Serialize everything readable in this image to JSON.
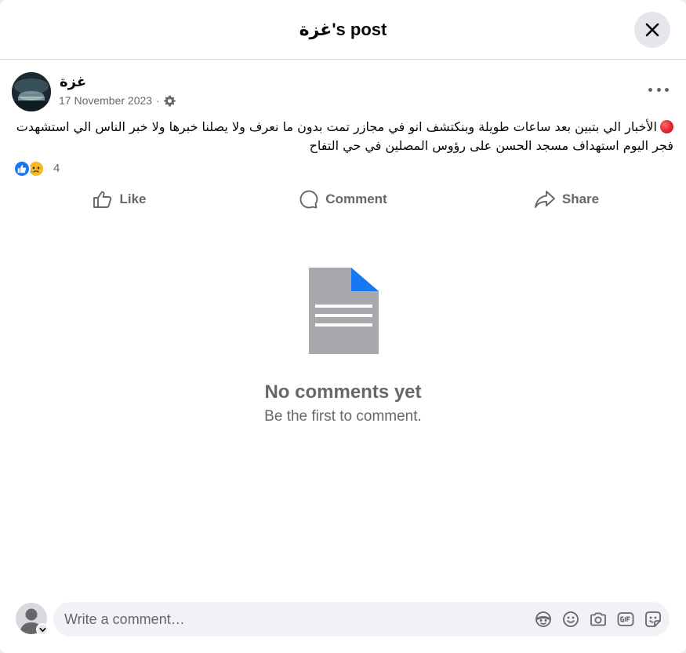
{
  "header": {
    "title": "غزة's post"
  },
  "post": {
    "author": "غزة",
    "date": "17 November 2023",
    "separator": "·",
    "lines": [
      "الأخبار الي بتبين بعد ساعات طويلة وبنكتشف انو في مجازر تمت بدون ما نعرف ولا يصلنا خبرها ولا خبر الناس الي استشهدت",
      "فجر اليوم استهداف مسجد الحسن على رؤوس المصلين في حي التفاح"
    ],
    "reaction_count": "4"
  },
  "actions": {
    "like": "Like",
    "comment": "Comment",
    "share": "Share"
  },
  "empty_state": {
    "title": "No comments yet",
    "subtitle": "Be the first to comment."
  },
  "composer": {
    "placeholder": "Write a comment…"
  },
  "colors": {
    "accent": "#1877f2",
    "muted": "#65676b",
    "reaction_sad": "#f7b928"
  },
  "icons": {
    "close": "close-icon",
    "gear": "gear-icon",
    "more": "more-icon",
    "like": "thumbs-up-icon",
    "comment": "speech-bubble-icon",
    "share": "share-arrow-icon",
    "document": "document-icon",
    "avatar_chevron": "chevron-down-icon",
    "tools": [
      "avatar-sticker-icon",
      "emoji-icon",
      "camera-icon",
      "gif-icon",
      "sticker-icon"
    ]
  }
}
